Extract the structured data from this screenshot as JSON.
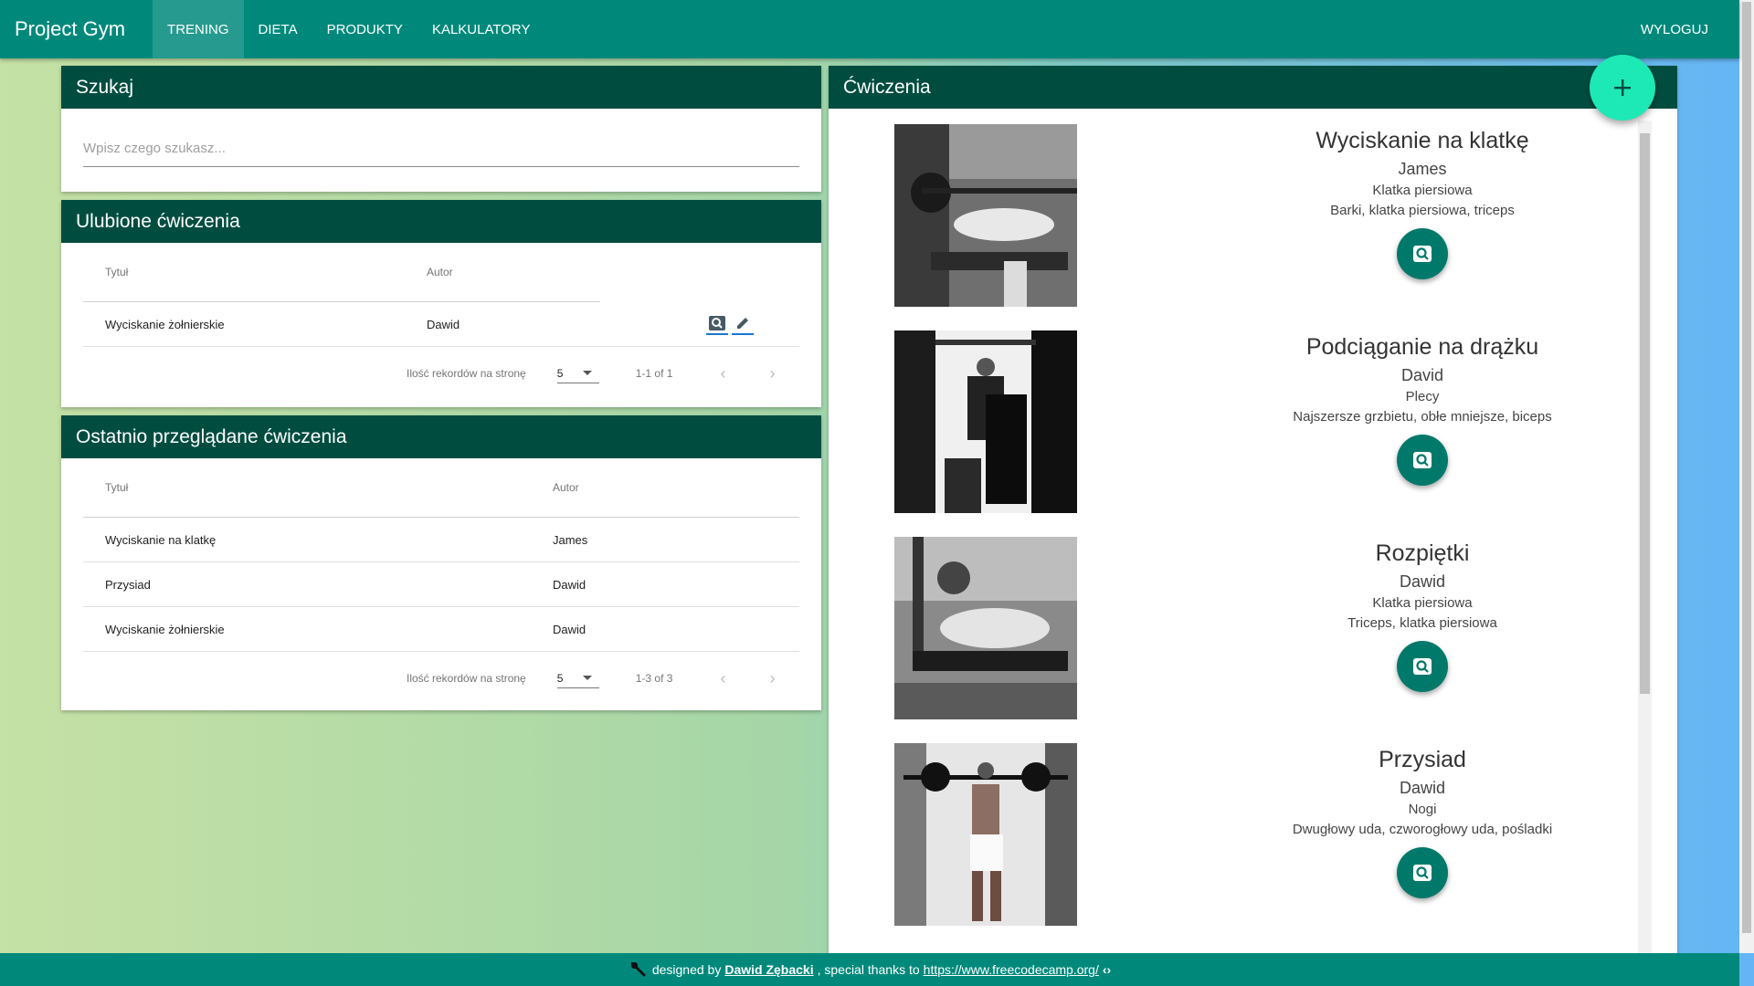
{
  "nav": {
    "brand": "Project Gym",
    "items": [
      {
        "label": "TRENING",
        "active": true
      },
      {
        "label": "DIETA",
        "active": false
      },
      {
        "label": "PRODUKTY",
        "active": false
      },
      {
        "label": "KALKULATORY",
        "active": false
      }
    ],
    "logout": "WYLOGUJ"
  },
  "search": {
    "title": "Szukaj",
    "placeholder": "Wpisz czego szukasz..."
  },
  "favorites": {
    "title": "Ulubione ćwiczenia",
    "col_title": "Tytuł",
    "col_author": "Autor",
    "rows": [
      {
        "title": "Wyciskanie żołnierskie",
        "author": "Dawid"
      }
    ],
    "per_page_label": "Ilość rekordów na stronę",
    "per_page": "5",
    "range": "1-1 of 1"
  },
  "recent": {
    "title": "Ostatnio przeglądane ćwiczenia",
    "col_title": "Tytuł",
    "col_author": "Autor",
    "rows": [
      {
        "title": "Wyciskanie na klatkę",
        "author": "James"
      },
      {
        "title": "Przysiad",
        "author": "Dawid"
      },
      {
        "title": "Wyciskanie żołnierskie",
        "author": "Dawid"
      }
    ],
    "per_page_label": "Ilość rekordów na stronę",
    "per_page": "5",
    "range": "1-3 of 3"
  },
  "exercises": {
    "title": "Ćwiczenia",
    "items": [
      {
        "title": "Wyciskanie na klatkę",
        "author": "James",
        "part": "Klatka piersiowa",
        "muscles": "Barki, klatka piersiowa, triceps"
      },
      {
        "title": "Podciąganie na drążku",
        "author": "David",
        "part": "Plecy",
        "muscles": "Najszersze grzbietu, obłe mniejsze, biceps"
      },
      {
        "title": "Rozpiętki",
        "author": "Dawid",
        "part": "Klatka piersiowa",
        "muscles": "Triceps, klatka piersiowa"
      },
      {
        "title": "Przysiad",
        "author": "Dawid",
        "part": "Nogi",
        "muscles": "Dwugłowy uda, czworogłowy uda, pośladki"
      }
    ]
  },
  "footer": {
    "prefix": "designed by",
    "author": "Dawid Zębacki",
    "middle": ", special thanks to",
    "link": "https://www.freecodecamp.org/"
  },
  "colors": {
    "nav": "#00897b",
    "card_header": "#004d40",
    "fab": "#1de9b6",
    "action": "#00796b"
  }
}
